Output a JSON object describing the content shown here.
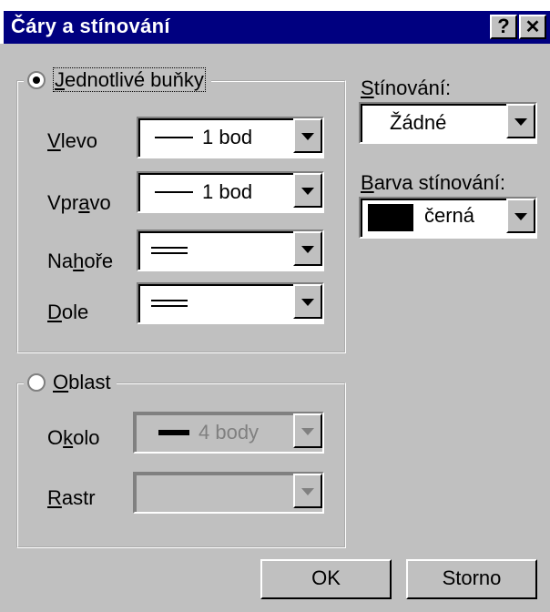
{
  "window": {
    "title": "Čáry a stínování",
    "help_button": "?",
    "close_button": "✕"
  },
  "cells_group": {
    "option_label": "Jednotlivé buňky",
    "selected": true,
    "rows": [
      {
        "label": "Vlevo",
        "value": "1 bod"
      },
      {
        "label": "Vpravo",
        "value": "1 bod"
      },
      {
        "label": "Nahoře",
        "value": ""
      },
      {
        "label": "Dole",
        "value": ""
      }
    ]
  },
  "area_group": {
    "option_label": "Oblast",
    "selected": false,
    "rows": [
      {
        "label": "Okolo",
        "value": "4 body"
      },
      {
        "label": "Rastr",
        "value": ""
      }
    ]
  },
  "shading": {
    "label": "Stínování:",
    "value": "Žádné"
  },
  "shading_color": {
    "label": "Barva stínování:",
    "value": "černá",
    "swatch_color": "#000000"
  },
  "buttons": {
    "ok": "OK",
    "cancel": "Storno"
  },
  "colors": {
    "titlebar": "#000080",
    "face": "#c0c0c0"
  }
}
